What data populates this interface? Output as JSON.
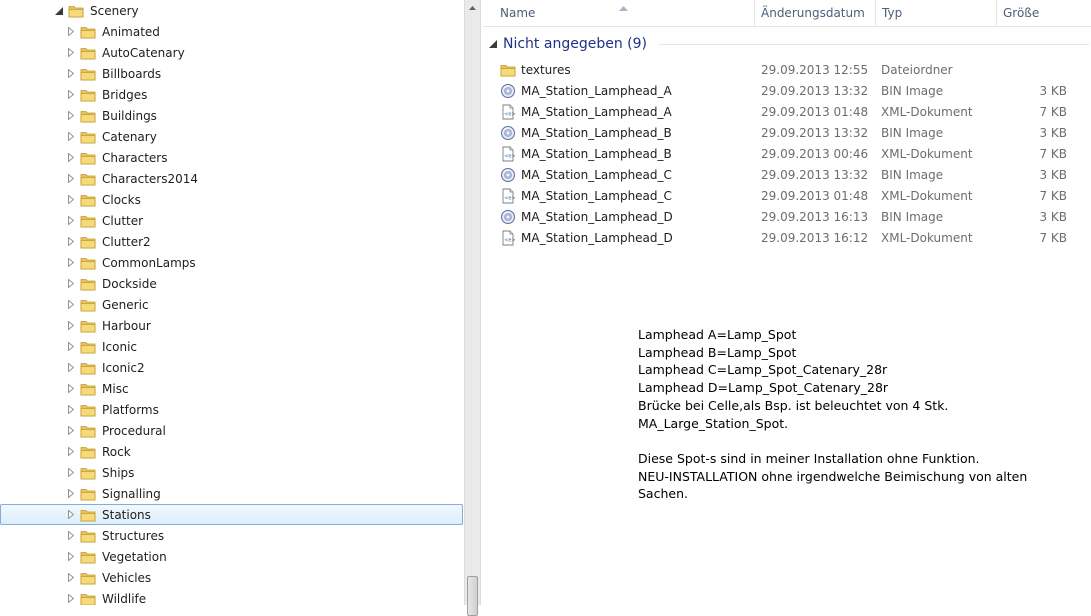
{
  "tree": {
    "root_label": "Scenery",
    "items": [
      "Animated",
      "AutoCatenary",
      "Billboards",
      "Bridges",
      "Buildings",
      "Catenary",
      "Characters",
      "Characters2014",
      "Clocks",
      "Clutter",
      "Clutter2",
      "CommonLamps",
      "Dockside",
      "Generic",
      "Harbour",
      "Iconic",
      "Iconic2",
      "Misc",
      "Platforms",
      "Procedural",
      "Rock",
      "Ships",
      "Signalling",
      "Stations",
      "Structures",
      "Vegetation",
      "Vehicles",
      "Wildlife"
    ],
    "selected": "Stations"
  },
  "columns": {
    "name": "Name",
    "date": "Änderungsdatum",
    "type": "Typ",
    "size": "Größe"
  },
  "group": {
    "label": "Nicht angegeben (9)"
  },
  "files": [
    {
      "name": "textures",
      "date": "29.09.2013 12:55",
      "type": "Dateiordner",
      "size": "",
      "icon": "folder-icon"
    },
    {
      "name": "MA_Station_Lamphead_A",
      "date": "29.09.2013 13:32",
      "type": "BIN Image",
      "size": "3 KB",
      "icon": "bin-file-icon"
    },
    {
      "name": "MA_Station_Lamphead_A",
      "date": "29.09.2013 01:48",
      "type": "XML-Dokument",
      "size": "7 KB",
      "icon": "xml-file-icon"
    },
    {
      "name": "MA_Station_Lamphead_B",
      "date": "29.09.2013 13:32",
      "type": "BIN Image",
      "size": "3 KB",
      "icon": "bin-file-icon"
    },
    {
      "name": "MA_Station_Lamphead_B",
      "date": "29.09.2013 00:46",
      "type": "XML-Dokument",
      "size": "7 KB",
      "icon": "xml-file-icon"
    },
    {
      "name": "MA_Station_Lamphead_C",
      "date": "29.09.2013 13:32",
      "type": "BIN Image",
      "size": "3 KB",
      "icon": "bin-file-icon"
    },
    {
      "name": "MA_Station_Lamphead_C",
      "date": "29.09.2013 01:48",
      "type": "XML-Dokument",
      "size": "7 KB",
      "icon": "xml-file-icon"
    },
    {
      "name": "MA_Station_Lamphead_D",
      "date": "29.09.2013 16:13",
      "type": "BIN Image",
      "size": "3 KB",
      "icon": "bin-file-icon"
    },
    {
      "name": "MA_Station_Lamphead_D",
      "date": "29.09.2013 16:12",
      "type": "XML-Dokument",
      "size": "7 KB",
      "icon": "xml-file-icon"
    }
  ],
  "note": {
    "lines": [
      "Lamphead A=Lamp_Spot",
      "Lamphead B=Lamp_Spot",
      "Lamphead C=Lamp_Spot_Catenary_28r",
      "Lamphead D=Lamp_Spot_Catenary_28r",
      "Brücke bei Celle,als Bsp. ist beleuchtet von 4 Stk.",
      "MA_Large_Station_Spot.",
      "",
      "Diese Spot-s sind in meiner Installation ohne Funktion.",
      "NEU-INSTALLATION ohne irgendwelche Beimischung von alten",
      "Sachen."
    ]
  },
  "colors": {
    "selection_border": "#84acdd",
    "group_text": "#1e3287",
    "header_text": "#4c607a"
  }
}
